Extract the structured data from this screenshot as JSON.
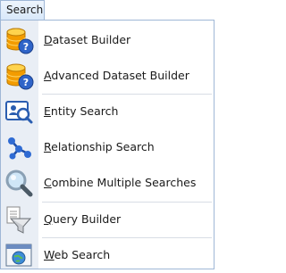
{
  "menu": {
    "title": "Search"
  },
  "items": [
    {
      "accel": "D",
      "rest": "ataset Builder",
      "icon": "dataset-builder-icon"
    },
    {
      "accel": "A",
      "rest": "dvanced Dataset Builder",
      "icon": "advanced-dataset-builder-icon"
    },
    {
      "accel": "E",
      "rest": "ntity Search",
      "icon": "entity-search-icon"
    },
    {
      "accel": "R",
      "rest": "elationship Search",
      "icon": "relationship-search-icon"
    },
    {
      "accel": "C",
      "rest": "ombine Multiple Searches",
      "icon": "magnifier-icon"
    },
    {
      "accel": "Q",
      "rest": "uery Builder",
      "icon": "funnel-icon"
    },
    {
      "accel": "W",
      "rest": "eb Search",
      "icon": "web-search-icon"
    }
  ]
}
